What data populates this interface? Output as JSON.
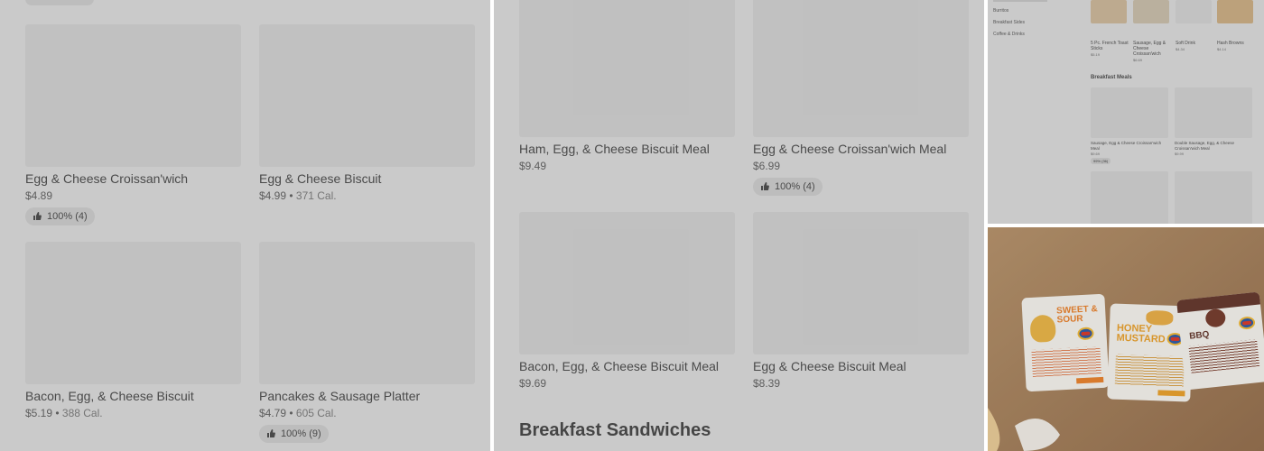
{
  "panel1": {
    "cards": [
      {
        "name": "Egg & Cheese Croissan'wich",
        "price": "$4.89",
        "cal": "",
        "badge": "100% (4)"
      },
      {
        "name": "Egg & Cheese Biscuit",
        "price": "$4.99",
        "cal": "371 Cal.",
        "badge": ""
      },
      {
        "name": "Bacon, Egg, & Cheese Biscuit",
        "price": "$5.19",
        "cal": "388 Cal.",
        "badge": ""
      },
      {
        "name": "Pancakes & Sausage Platter",
        "price": "$4.79",
        "cal": "605 Cal.",
        "badge": "100% (9)"
      }
    ]
  },
  "panel2": {
    "cards": [
      {
        "name": "Ham, Egg, & Cheese Biscuit Meal",
        "price": "$9.49",
        "badge": ""
      },
      {
        "name": "Egg & Cheese Croissan'wich Meal",
        "price": "$6.99",
        "badge": "100% (4)"
      },
      {
        "name": "Bacon, Egg, & Cheese Biscuit Meal",
        "price": "$9.69",
        "badge": ""
      },
      {
        "name": "Egg & Cheese Biscuit Meal",
        "price": "$8.39",
        "badge": ""
      }
    ],
    "section_title": "Breakfast Sandwiches"
  },
  "panel3": {
    "nav": [
      "Burritos",
      "Breakfast Sides",
      "Coffee & Drinks"
    ],
    "top_items": [
      {
        "name": "5 Pc. French Toast Sticks",
        "price": "$5.19"
      },
      {
        "name": "Sausage, Egg & Cheese Croissan'wich",
        "price": "$6.69"
      },
      {
        "name": "Soft Drink",
        "price": "$4.34"
      },
      {
        "name": "Hash Browns",
        "price": "$4.14"
      }
    ],
    "section_head": "Breakfast Meals",
    "meals": [
      {
        "name": "Sausage, Egg & Cheese Croissan'wich Meal",
        "price": "$9.69",
        "badge": "99% (36)"
      },
      {
        "name": "Double Sausage, Egg, & Cheese Croissan'wich Meal",
        "price": "$9.99",
        "badge": ""
      }
    ]
  },
  "panel4": {
    "packets": [
      {
        "label": "SWEET & SOUR",
        "color": "#e8791e"
      },
      {
        "label": "HONEY MUSTARD",
        "color": "#e89a1e"
      },
      {
        "label": "BBQ",
        "color": "#5a2a1e"
      }
    ]
  }
}
